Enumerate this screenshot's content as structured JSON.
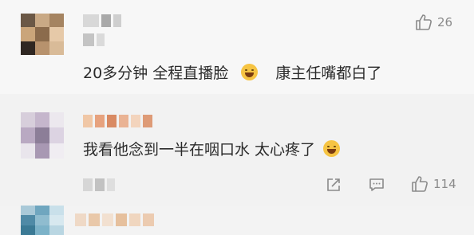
{
  "comments": [
    {
      "text_part1": "20多分钟  全程直播脸",
      "text_part2": "康主任嘴都白了",
      "emoji": "laughing-tears-emoji",
      "likes": "26"
    },
    {
      "text_part1": "我看他念到一半在咽口水  太心疼了",
      "emoji": "crying-laughing-emoji",
      "likes": "114",
      "actions": [
        "share-icon",
        "reply-icon",
        "like-icon"
      ]
    }
  ],
  "colors": {
    "icon_gray": "#8a8a8a",
    "text": "#2b2b2b"
  }
}
